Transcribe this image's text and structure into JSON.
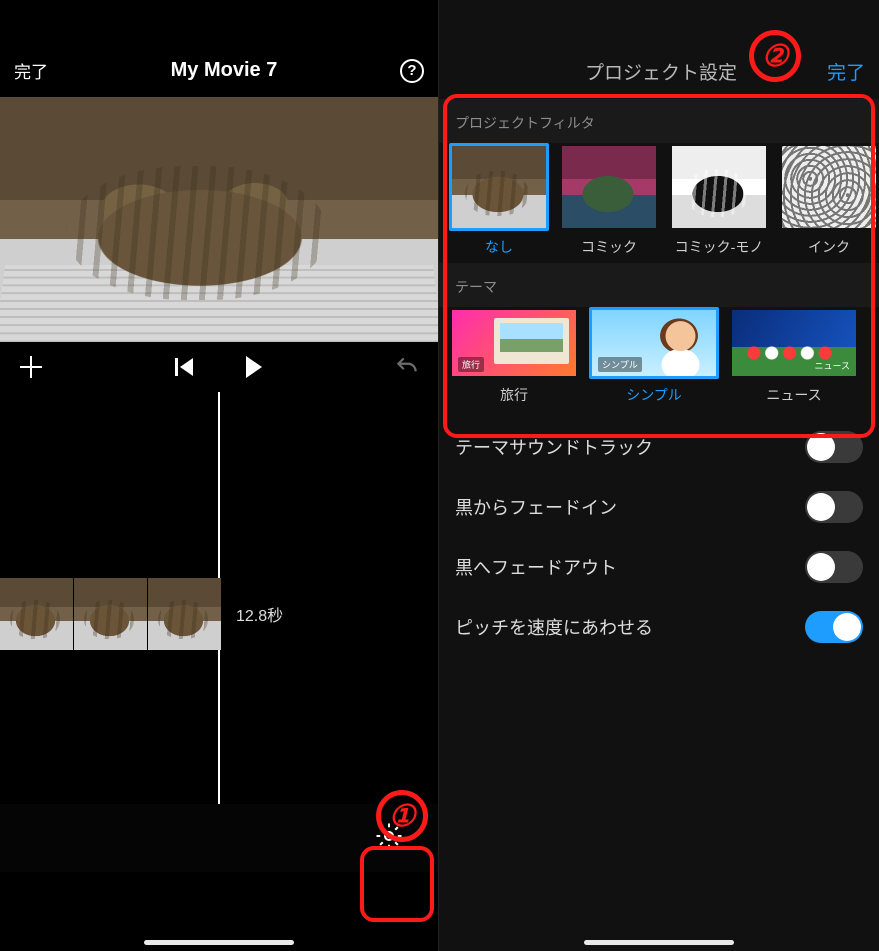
{
  "left": {
    "done": "完了",
    "title": "My Movie 7",
    "duration": "12.8秒",
    "callout1": "①"
  },
  "right": {
    "title": "プロジェクト設定",
    "done": "完了",
    "callout2": "②",
    "filter_section": "プロジェクトフィルタ",
    "filters": [
      {
        "label": "なし"
      },
      {
        "label": "コミック"
      },
      {
        "label": "コミック-モノ"
      },
      {
        "label": "インク"
      }
    ],
    "theme_section": "テーマ",
    "themes": [
      {
        "label": "旅行",
        "tag": "旅行"
      },
      {
        "label": "シンプル",
        "tag": "シンプル"
      },
      {
        "label": "ニュース",
        "tag": "ニュース"
      }
    ],
    "settings": [
      {
        "label": "テーマサウンドトラック",
        "on": false
      },
      {
        "label": "黒からフェードイン",
        "on": false
      },
      {
        "label": "黒へフェードアウト",
        "on": false
      },
      {
        "label": "ピッチを速度にあわせる",
        "on": true
      }
    ]
  }
}
